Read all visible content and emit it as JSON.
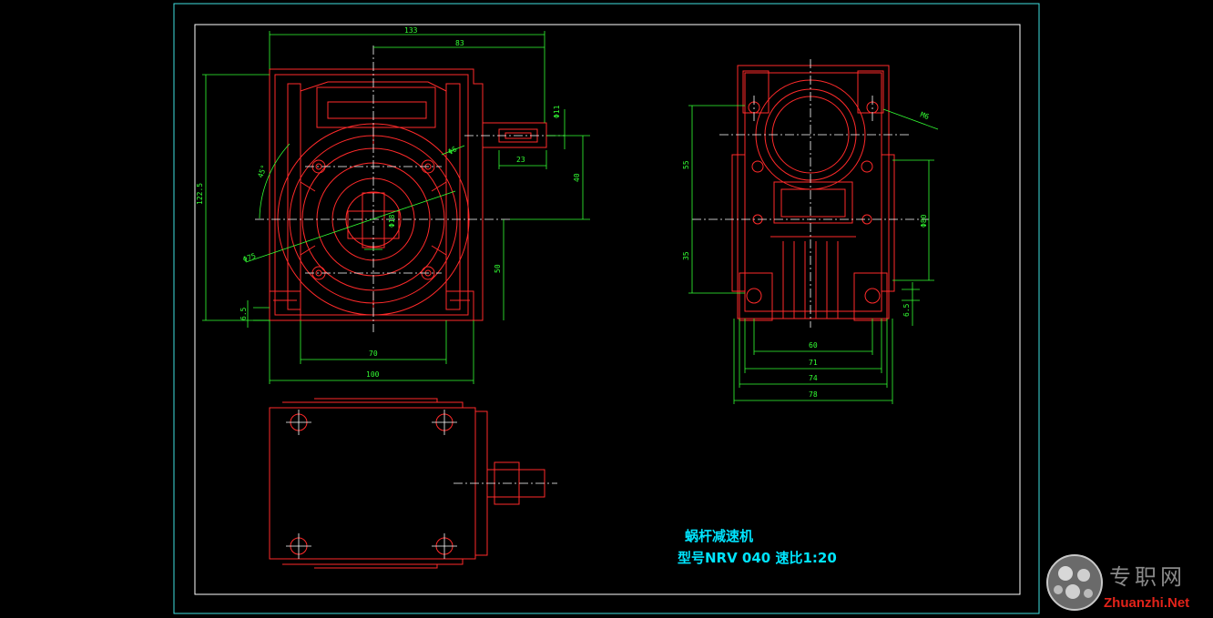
{
  "title_block": {
    "name": "蜗杆减速机",
    "model": "型号NRV 040  速比1:20"
  },
  "front_view": {
    "dims": [
      "133",
      "83",
      "Φ11",
      "Φ6",
      "23",
      "40",
      "122.5",
      "45°",
      "Φ18",
      "Φ75",
      "50",
      "6.5",
      "70",
      "100"
    ]
  },
  "side_view": {
    "dims": [
      "M6",
      "55",
      "35",
      "Φ80",
      "6.5",
      "60",
      "71",
      "74",
      "78"
    ]
  },
  "watermark": {
    "cn": "专职网",
    "en": "Zhuanzhi.Net"
  },
  "colors": {
    "background": "#000000",
    "outline": "#ff2a2a",
    "dimension": "#33ff33",
    "frame": "#ffffff",
    "title": "#00e5ff"
  }
}
